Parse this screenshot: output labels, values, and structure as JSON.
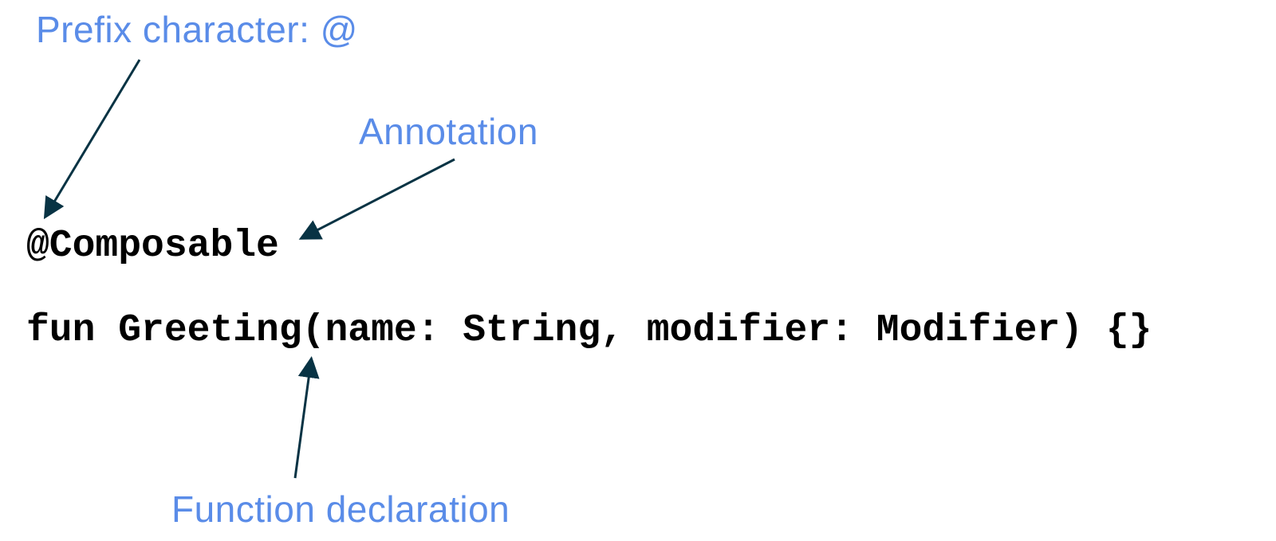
{
  "labels": {
    "prefix": "Prefix character: @",
    "annotation": "Annotation",
    "function_declaration": "Function declaration"
  },
  "code": {
    "line1": "@Composable",
    "line2": "fun Greeting(name: String, modifier: Modifier) {}"
  },
  "colors": {
    "label": "#5a8ce8",
    "arrow": "#083344",
    "code": "#000000"
  }
}
